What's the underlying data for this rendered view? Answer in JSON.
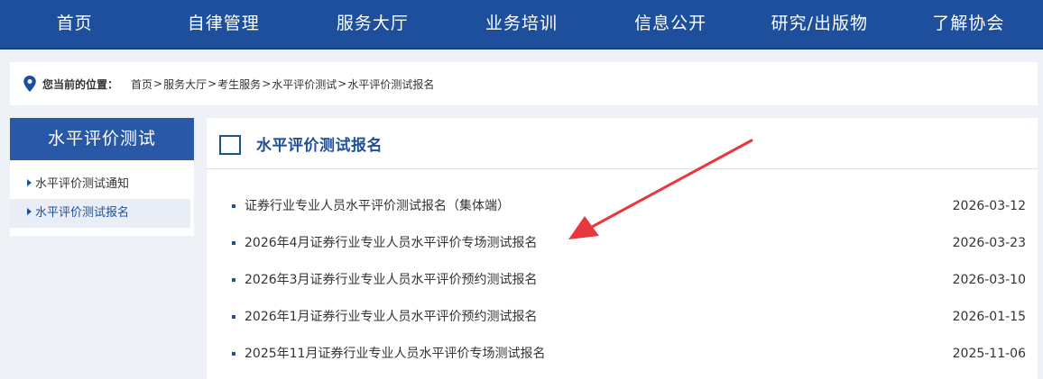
{
  "nav": {
    "items": [
      {
        "label": "首页"
      },
      {
        "label": "自律管理"
      },
      {
        "label": "服务大厅"
      },
      {
        "label": "业务培训"
      },
      {
        "label": "信息公开"
      },
      {
        "label": "研究/出版物"
      },
      {
        "label": "了解协会"
      }
    ]
  },
  "breadcrumb": {
    "label": "您当前的位置：",
    "items": [
      "首页",
      "服务大厅",
      "考生服务",
      "水平评价测试",
      "水平评价测试报名"
    ],
    "separator": ">"
  },
  "sidebar": {
    "title": "水平评价测试",
    "items": [
      {
        "label": "水平评价测试通知"
      },
      {
        "label": "水平评价测试报名"
      }
    ]
  },
  "main": {
    "title": "水平评价测试报名",
    "rows": [
      {
        "title": "证券行业专业人员水平评价测试报名（集体端）",
        "date": "2026-03-12"
      },
      {
        "title": "2026年4月证券行业专业人员水平评价专场测试报名",
        "date": "2026-03-23"
      },
      {
        "title": "2026年3月证券行业专业人员水平评价预约测试报名",
        "date": "2026-03-10"
      },
      {
        "title": "2026年1月证券行业专业人员水平评价预约测试报名",
        "date": "2026-01-15"
      },
      {
        "title": "2025年11月证券行业专业人员水平评价专场测试报名",
        "date": "2025-11-06"
      }
    ]
  },
  "colors": {
    "nav_bg": "#1e4f9c",
    "accent": "#2858a6",
    "arrow": "#e8383d"
  },
  "icons": {
    "location": "map-pin-icon",
    "bullet": "triangle-right-icon",
    "section": "square-frame-icon"
  }
}
